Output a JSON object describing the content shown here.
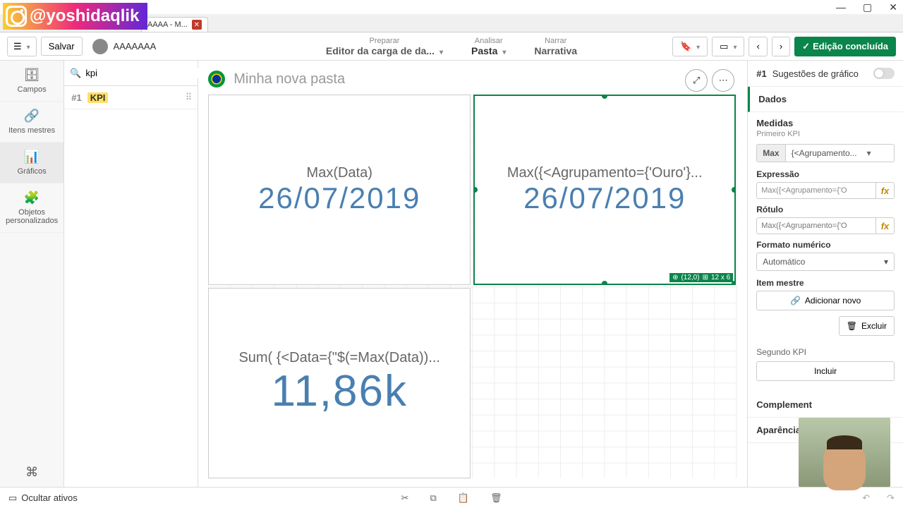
{
  "overlay": {
    "handle": "@yoshidaqlik"
  },
  "window": {
    "tab_title": "AAAA - M..."
  },
  "toolbar": {
    "save": "Salvar",
    "app_name": "AAAAAAA",
    "nav": [
      {
        "top": "Preparar",
        "label": "Editor da carga de da..."
      },
      {
        "top": "Analisar",
        "label": "Pasta"
      },
      {
        "top": "Narrar",
        "label": "Narrativa"
      }
    ],
    "done": "Edição concluída"
  },
  "sidebar1": {
    "items": [
      {
        "label": "Campos"
      },
      {
        "label": "Itens mestres"
      },
      {
        "label": "Gráficos"
      },
      {
        "label": "Objetos personalizados"
      }
    ]
  },
  "search": {
    "value": "kpi"
  },
  "asset": {
    "index": "#1",
    "name": "KPI"
  },
  "sheet": {
    "title": "Minha nova pasta"
  },
  "kpis": [
    {
      "title": "Max(Data)",
      "value": "26/07/2019"
    },
    {
      "title": "Max({<Agrupamento={'Ouro'}...",
      "value": "26/07/2019"
    },
    {
      "title": "Sum( {<Data={\"$(=Max(Data))...",
      "value": "11,86k"
    }
  ],
  "pos_badge": {
    "pos": "(12,0)",
    "size": "12 x 6"
  },
  "props": {
    "head_index": "#1",
    "head_title": "Sugestões de gráfico",
    "acc_data": "Dados",
    "medidas_h": "Medidas",
    "medidas_sub": "Primeiro KPI",
    "agg": "Max",
    "agg_field": "{<Agrupamento...",
    "expr_label": "Expressão",
    "expr_value": "Max({<Agrupamento={'O",
    "rotulo_label": "Rótulo",
    "rotulo_value": "Max({<Agrupamento={'O",
    "format_label": "Formato numérico",
    "format_value": "Automático",
    "master_label": "Item mestre",
    "add_new": "Adicionar novo",
    "delete": "Excluir",
    "second_kpi": "Segundo KPI",
    "include": "Incluir",
    "acc_compl": "Complement",
    "acc_apar": "Aparência"
  },
  "footer": {
    "hide": "Ocultar ativos"
  }
}
